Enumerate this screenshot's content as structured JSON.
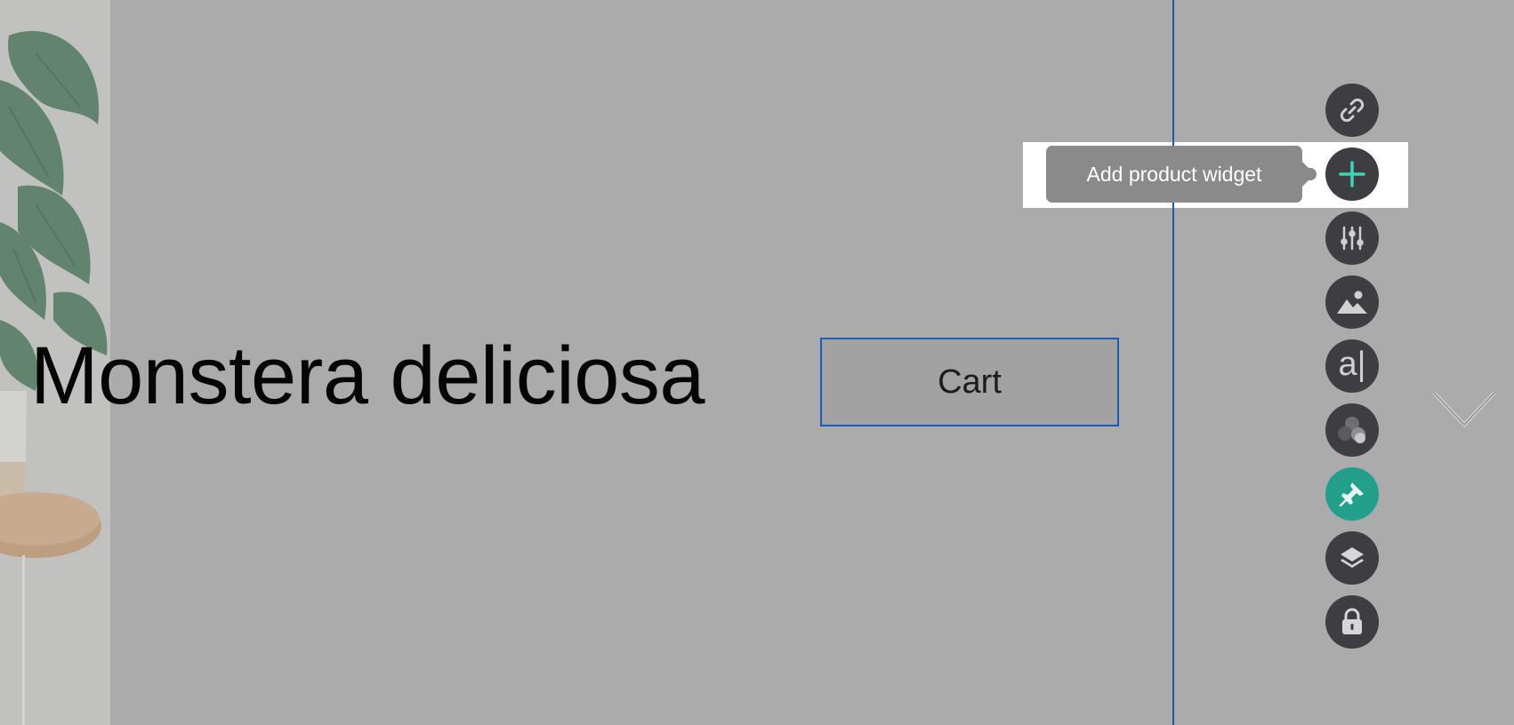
{
  "product": {
    "title": "Monstera deliciosa",
    "cart_label": "Cart"
  },
  "tooltip": {
    "label": "Add product widget"
  },
  "toolbar": {
    "tools": [
      {
        "name": "link-icon",
        "active": false
      },
      {
        "name": "plus-icon",
        "active": false
      },
      {
        "name": "sliders-icon",
        "active": false
      },
      {
        "name": "image-icon",
        "active": false
      },
      {
        "name": "text-icon",
        "glyph": "a|",
        "active": false
      },
      {
        "name": "effects-icon",
        "active": false
      },
      {
        "name": "pin-icon",
        "active": true
      },
      {
        "name": "layers-icon",
        "active": false
      },
      {
        "name": "lock-icon",
        "active": false
      }
    ]
  },
  "colors": {
    "background": "#ababab",
    "guide_line": "#1e5bb8",
    "toolbar_button": "#3e3e42",
    "active_tool": "#23a08c",
    "plus_accent": "#3ad6b8",
    "tooltip_bg": "#8a8a8a"
  }
}
